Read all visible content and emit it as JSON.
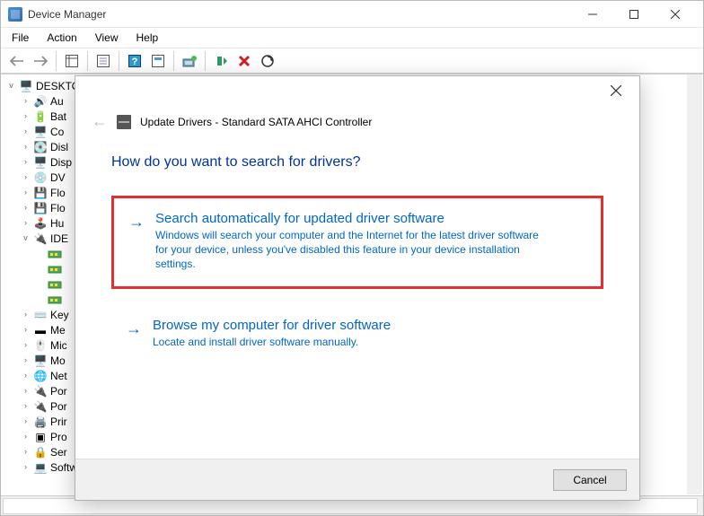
{
  "window": {
    "title": "Device Manager"
  },
  "menubar": {
    "file": "File",
    "action": "Action",
    "view": "View",
    "help": "Help"
  },
  "tree": {
    "root": "DESKTO",
    "items": [
      {
        "label": "Au",
        "icon": "audio"
      },
      {
        "label": "Bat",
        "icon": "battery"
      },
      {
        "label": "Co",
        "icon": "computer"
      },
      {
        "label": "Disl",
        "icon": "disk"
      },
      {
        "label": "Disp",
        "icon": "display"
      },
      {
        "label": "DV",
        "icon": "dvd"
      },
      {
        "label": "Flo",
        "icon": "floppy"
      },
      {
        "label": "Flo",
        "icon": "floppy"
      },
      {
        "label": "Hu",
        "icon": "hid"
      },
      {
        "label": "IDE",
        "icon": "ide",
        "expanded": true,
        "children": 4
      },
      {
        "label": "Key",
        "icon": "keyboard"
      },
      {
        "label": "Me",
        "icon": "memory"
      },
      {
        "label": "Mic",
        "icon": "mouse"
      },
      {
        "label": "Mo",
        "icon": "monitor"
      },
      {
        "label": "Net",
        "icon": "network"
      },
      {
        "label": "Por",
        "icon": "port"
      },
      {
        "label": "Por",
        "icon": "port"
      },
      {
        "label": "Prir",
        "icon": "printer"
      },
      {
        "label": "Pro",
        "icon": "processor"
      },
      {
        "label": "Ser",
        "icon": "security"
      },
      {
        "label": "Software devices",
        "icon": "software",
        "noexp": false
      }
    ]
  },
  "dialog": {
    "header": "Update Drivers - Standard SATA AHCI Controller",
    "question": "How do you want to search for drivers?",
    "option1_title": "Search automatically for updated driver software",
    "option1_desc": "Windows will search your computer and the Internet for the latest driver software for your device, unless you've disabled this feature in your device installation settings.",
    "option2_title": "Browse my computer for driver software",
    "option2_desc": "Locate and install driver software manually.",
    "cancel": "Cancel"
  }
}
